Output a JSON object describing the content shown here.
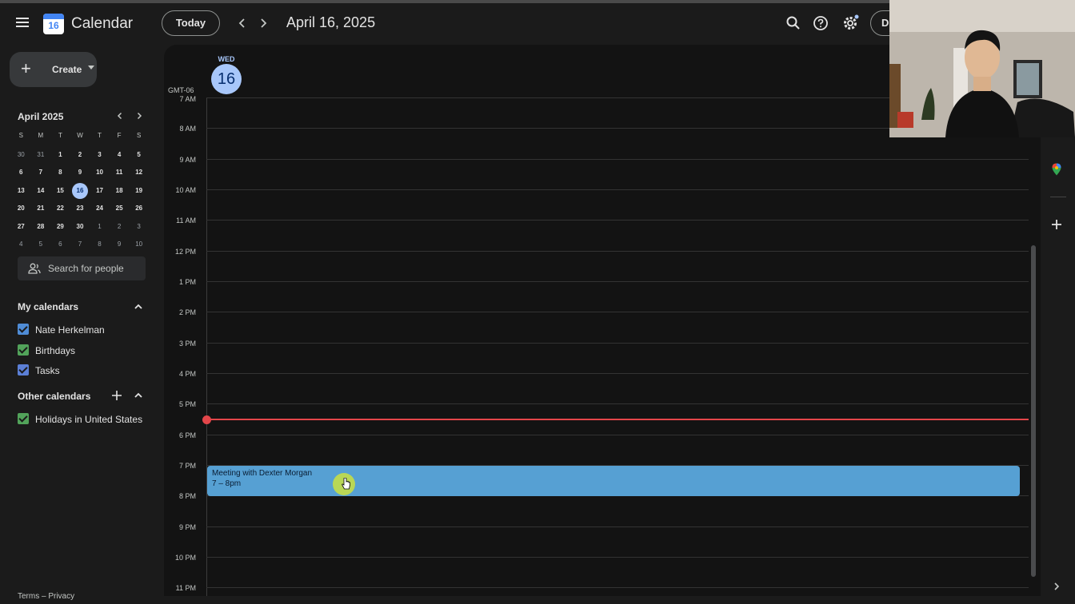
{
  "header": {
    "app_title": "Calendar",
    "logo_day": "16",
    "today_label": "Today",
    "current_date": "April 16, 2025",
    "view_initial": "D"
  },
  "sidebar": {
    "create_label": "Create",
    "mini_calendar": {
      "title": "April 2025",
      "weekdays": [
        "S",
        "M",
        "T",
        "W",
        "T",
        "F",
        "S"
      ],
      "weeks": [
        [
          "30",
          "31",
          "1",
          "2",
          "3",
          "4",
          "5"
        ],
        [
          "6",
          "7",
          "8",
          "9",
          "10",
          "11",
          "12"
        ],
        [
          "13",
          "14",
          "15",
          "16",
          "17",
          "18",
          "19"
        ],
        [
          "20",
          "21",
          "22",
          "23",
          "24",
          "25",
          "26"
        ],
        [
          "27",
          "28",
          "29",
          "30",
          "1",
          "2",
          "3"
        ],
        [
          "4",
          "5",
          "6",
          "7",
          "8",
          "9",
          "10"
        ]
      ],
      "selected": "16"
    },
    "search_people_placeholder": "Search for people",
    "my_calendars_title": "My calendars",
    "my_calendars": [
      {
        "label": "Nate Herkelman",
        "color": "#4f8cd6"
      },
      {
        "label": "Birthdays",
        "color": "#52a35a"
      },
      {
        "label": "Tasks",
        "color": "#5b7fd6"
      }
    ],
    "other_calendars_title": "Other calendars",
    "other_calendars": [
      {
        "label": "Holidays in United States",
        "color": "#52a35a"
      }
    ],
    "footer": "Terms – Privacy"
  },
  "day_view": {
    "day_name": "WED",
    "day_number": "16",
    "timezone": "GMT-06",
    "hours": [
      "7 AM",
      "8 AM",
      "9 AM",
      "10 AM",
      "11 AM",
      "12 PM",
      "1 PM",
      "2 PM",
      "3 PM",
      "4 PM",
      "5 PM",
      "6 PM",
      "7 PM",
      "8 PM",
      "9 PM",
      "10 PM",
      "11 PM"
    ],
    "event": {
      "title": "Meeting with Dexter Morgan",
      "time": "7 – 8pm",
      "color": "#56a0d3"
    },
    "now_indicator_color": "#e3464a"
  },
  "colors": {
    "accent": "#a8c7fa",
    "background": "#1b1b1b",
    "grid_background": "#131313"
  }
}
